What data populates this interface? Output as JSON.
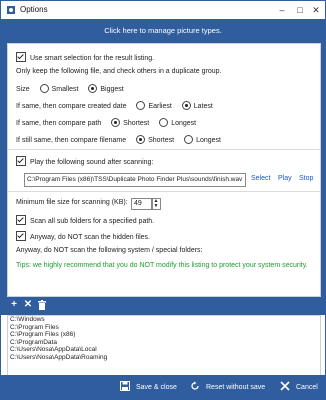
{
  "window": {
    "title": "Options"
  },
  "banner": "Click here to manage picture types.",
  "smart": {
    "checkbox_label": "Use smart selection for the result listing.",
    "keep_text": "Only keep the following file, and check others in a duplicate group.",
    "size_label": "Size",
    "size_options": [
      "Smallest",
      "Biggest"
    ],
    "date_label": "If same, then compare created date",
    "date_options": [
      "Earliest",
      "Latest"
    ],
    "path_label": "If same, then compare path",
    "path_options": [
      "Shortest",
      "Longest"
    ],
    "name_label": "If still same, then compare filename",
    "name_options": [
      "Shortest",
      "Longest"
    ]
  },
  "sound": {
    "checkbox_label": "Play the following sound after scanning:",
    "path_value": "C:\\Program Files (x86)\\TSS\\Duplicate Photo Finder Plus\\sounds\\finish.wav",
    "select_link": "Select",
    "play_link": "Play",
    "stop_link": "Stop"
  },
  "scan": {
    "min_size_label": "Minimum file size for scanning (KB):",
    "min_size_value": "49",
    "subfolders_label": "Scan all sub folders for a specified path.",
    "hidden_label": "Anyway, do NOT scan the hidden files.",
    "system_label": "Anyway, do NOT scan the following system / special folders:",
    "tip": "Tips: we highly recommend that you do NOT modify this listing to protect your system security."
  },
  "folders": [
    "C:\\Windows",
    "C:\\Program Files",
    "C:\\Program Files (x86)",
    "C:\\ProgramData",
    "C:\\Users\\Nosa\\AppData\\Local",
    "C:\\Users\\Nosa\\AppData\\Roaming"
  ],
  "footer": {
    "save_label": "Save & close",
    "reset_label": "Reset without save",
    "cancel_label": "Cancel"
  },
  "colors": {
    "accent": "#2f5d9e",
    "link": "#1a56c6",
    "tip": "#1a9c2f"
  }
}
